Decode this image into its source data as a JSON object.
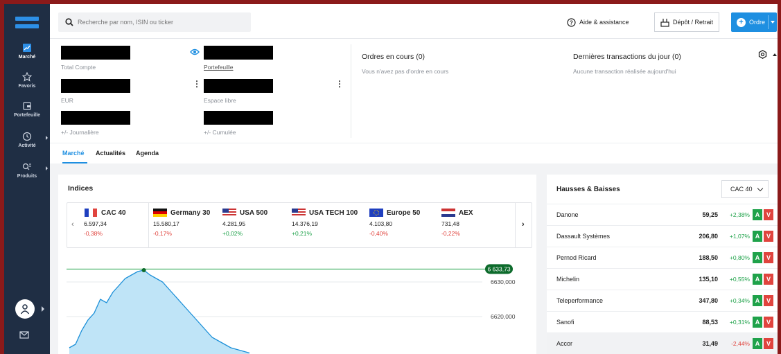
{
  "search": {
    "placeholder": "Recherche par nom, ISIN ou ticker"
  },
  "topbar": {
    "help_label": "Aide & assistance",
    "depot_label": "Dépôt / Retrait",
    "order_label": "Ordre"
  },
  "sidebar": {
    "items": [
      {
        "label": "Marché",
        "icon": "chart-icon"
      },
      {
        "label": "Favoris",
        "icon": "star-icon"
      },
      {
        "label": "Portefeuille",
        "icon": "wallet-icon"
      },
      {
        "label": "Activité",
        "icon": "clock-icon"
      },
      {
        "label": "Produits",
        "icon": "search-products-icon"
      }
    ]
  },
  "account": {
    "total_label": "Total Compte",
    "portfolio_label": "Portefeuille",
    "currency_label": "EUR",
    "free_label": "Espace libre",
    "daily_label": "+/- Journalière",
    "cumul_label": "+/- Cumulée"
  },
  "orders": {
    "title": "Ordres en cours (0)",
    "empty": "Vous n'avez pas d'ordre en cours"
  },
  "transactions": {
    "title": "Dernières transactions du jour (0)",
    "empty": "Aucune transaction réalisée aujourd'hui"
  },
  "tabs": [
    "Marché",
    "Actualités",
    "Agenda"
  ],
  "indices": {
    "title": "Indices",
    "items": [
      {
        "name": "CAC 40",
        "value": "6.597,34",
        "change": "-0,38%",
        "trend": "neg",
        "flag": "fr"
      },
      {
        "name": "Germany 30",
        "value": "15.580,17",
        "change": "-0,17%",
        "trend": "neg",
        "flag": "de"
      },
      {
        "name": "USA 500",
        "value": "4.281,95",
        "change": "+0,02%",
        "trend": "pos",
        "flag": "us"
      },
      {
        "name": "USA TECH 100",
        "value": "14.376,19",
        "change": "+0,21%",
        "trend": "pos",
        "flag": "us"
      },
      {
        "name": "Europe 50",
        "value": "4.103,80",
        "change": "-0,40%",
        "trend": "neg",
        "flag": "eu"
      },
      {
        "name": "AEX",
        "value": "731,48",
        "change": "-0,22%",
        "trend": "neg",
        "flag": "nl"
      }
    ]
  },
  "chart_data": {
    "type": "area",
    "title": "",
    "xlabel": "",
    "ylabel": "",
    "y_ticks": [
      "6630,000",
      "6620,000"
    ],
    "last_label": "6 633,73",
    "ylim": [
      6608,
      6636
    ],
    "series": [
      {
        "values": [
          6611,
          6612,
          6616,
          6619,
          6621,
          6625,
          6624,
          6627,
          6629,
          6631,
          6632,
          6633,
          6633.4,
          6632,
          6631,
          6630,
          6628,
          6626,
          6624,
          6622,
          6620,
          6618,
          6616,
          6614,
          6613,
          6612,
          6611,
          6610.5,
          6610,
          6609.5
        ]
      }
    ],
    "baseline": 6633.73
  },
  "movers": {
    "title": "Hausses & Baisses",
    "index_select": "CAC 40",
    "buy_label": "A",
    "sell_label": "V",
    "rows": [
      {
        "name": "Danone",
        "price": "59,25",
        "change": "+2,38%",
        "trend": "pos"
      },
      {
        "name": "Dassault Systèmes",
        "price": "206,80",
        "change": "+1,07%",
        "trend": "pos"
      },
      {
        "name": "Pernod Ricard",
        "price": "188,50",
        "change": "+0,80%",
        "trend": "pos"
      },
      {
        "name": "Michelin",
        "price": "135,10",
        "change": "+0,55%",
        "trend": "pos"
      },
      {
        "name": "Teleperformance",
        "price": "347,80",
        "change": "+0,34%",
        "trend": "pos"
      },
      {
        "name": "Sanofi",
        "price": "88,53",
        "change": "+0,31%",
        "trend": "pos"
      },
      {
        "name": "Accor",
        "price": "31,49",
        "change": "-2,44%",
        "trend": "neg"
      }
    ]
  }
}
